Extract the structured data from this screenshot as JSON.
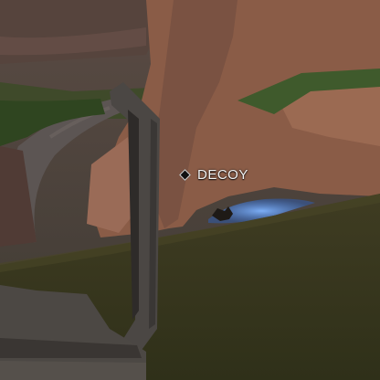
{
  "hud": {
    "marker_label": "DECOY",
    "marker_icon": "diamond-icon"
  },
  "colors": {
    "grass_near": "#3d3a22",
    "grass_far": "#3f5a2c",
    "rock": "#8a5c47",
    "rock_dark": "#5e3f33",
    "pillar": "#4b4744",
    "decoy_glow": "#3d7ad8"
  }
}
